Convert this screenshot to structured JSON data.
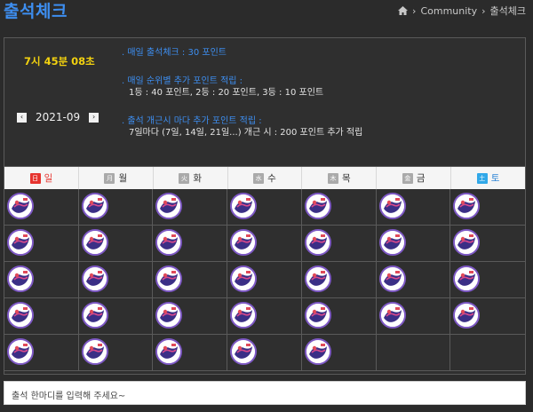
{
  "page": {
    "title": "출석체크"
  },
  "breadcrumb": {
    "section": "Community",
    "current": "출석체크"
  },
  "timer": "7시 45분 08초",
  "month": {
    "label": "2021-09",
    "prev": "‹",
    "next": "›"
  },
  "rules": [
    {
      "heading": ". 매일 출석체크 : 30 포인트",
      "lines": []
    },
    {
      "heading": ". 매일 순위별 추가 포인트 적립 :",
      "lines": [
        "1등 : 40 포인트,  2등 : 20 포인트,  3등 : 10 포인트"
      ]
    },
    {
      "heading": ". 출석 개근시 마다 추가 포인트 적립 :",
      "lines": [
        "7일마다 (7일, 14일, 21일...) 개근 시 : 200 포인트 추가 적립"
      ]
    }
  ],
  "weekdays": [
    {
      "box": "日",
      "label": "일",
      "kind": "sun"
    },
    {
      "box": "月",
      "label": "월",
      "kind": ""
    },
    {
      "box": "火",
      "label": "화",
      "kind": ""
    },
    {
      "box": "水",
      "label": "수",
      "kind": ""
    },
    {
      "box": "木",
      "label": "목",
      "kind": ""
    },
    {
      "box": "金",
      "label": "금",
      "kind": ""
    },
    {
      "box": "土",
      "label": "토",
      "kind": "sat"
    }
  ],
  "calendar": {
    "stamped": [
      true,
      true,
      true,
      true,
      true,
      true,
      true,
      true,
      true,
      true,
      true,
      true,
      true,
      true,
      true,
      true,
      true,
      true,
      true,
      true,
      true,
      true,
      true,
      true,
      true,
      true,
      true,
      true,
      true,
      true,
      true,
      true,
      true,
      false,
      false
    ]
  },
  "comment": {
    "placeholder": "출석 한마디를 입력해 주세요~"
  },
  "colors": {
    "accent": "#3d8ef0",
    "timer": "#f3d20f",
    "stamp_border": "#7e59c5"
  }
}
